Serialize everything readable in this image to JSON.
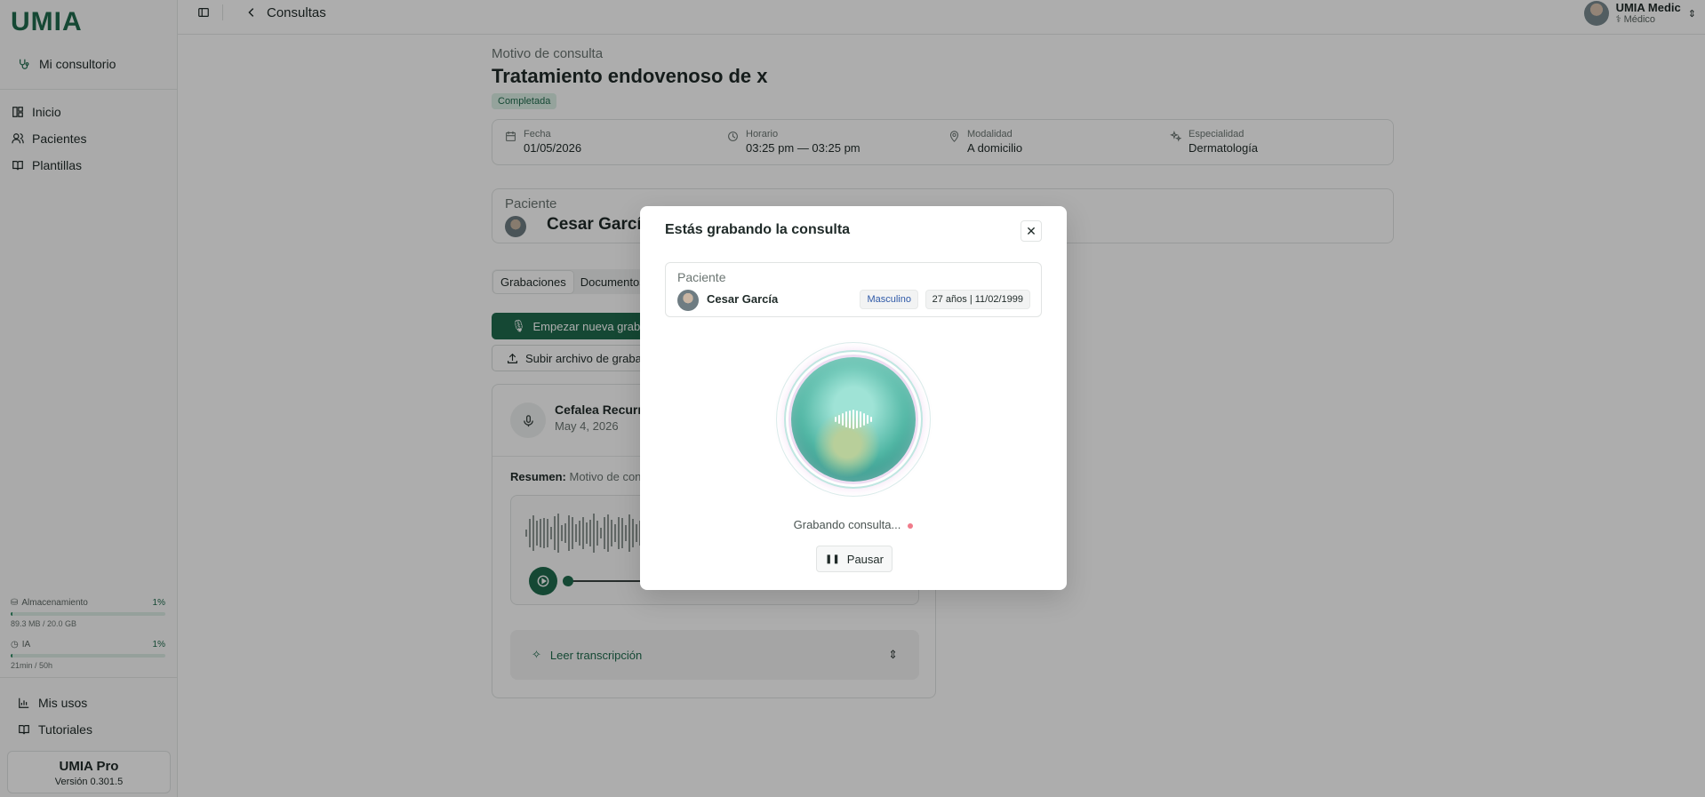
{
  "brand": {
    "logo": "UMIA"
  },
  "sidebar": {
    "office": "Mi consultorio",
    "items": [
      {
        "label": "Inicio",
        "icon": "dashboard-icon"
      },
      {
        "label": "Pacientes",
        "icon": "users-icon"
      },
      {
        "label": "Plantillas",
        "icon": "book-icon"
      }
    ],
    "storage": {
      "label": "Almacenamiento",
      "percent": "1%",
      "detail": "89.3 MB / 20.0 GB",
      "fill": 0.01
    },
    "ai": {
      "label": "IA",
      "percent": "1%",
      "detail": "21min / 50h",
      "fill": 0.01
    },
    "footer_items": [
      {
        "label": "Mis usos",
        "icon": "chart-icon"
      },
      {
        "label": "Tutoriales",
        "icon": "book-icon"
      }
    ],
    "plan": {
      "name": "UMIA Pro",
      "version": "Versión 0.301.5"
    }
  },
  "topbar": {
    "breadcrumb": "Consultas"
  },
  "user": {
    "name": "UMIA Medic",
    "role": "Médico"
  },
  "consult": {
    "kicker": "Motivo de consulta",
    "title": "Tratamiento endovenoso de x",
    "status": "Completada",
    "info": {
      "fecha_label": "Fecha",
      "fecha": "01/05/2026",
      "horario_label": "Horario",
      "horario": "03:25 pm — 03:25 pm",
      "modalidad_label": "Modalidad",
      "modalidad": "A domicilio",
      "especialidad_label": "Especialidad",
      "especialidad": "Dermatología"
    },
    "patient_label": "Paciente",
    "patient_name": "Cesar García",
    "tabs": [
      "Grabaciones",
      "Documentos"
    ],
    "btn_start": "Empezar nueva grabación",
    "btn_upload": "Subir archivo de grabación",
    "recording": {
      "title": "Cefalea Recurrente",
      "date": "May 4, 2026",
      "summary_label": "Resumen:",
      "summary": "Motivo de consulta"
    },
    "transcript": "Leer transcripción"
  },
  "modal": {
    "title": "Estás grabando la consulta",
    "patient_label": "Paciente",
    "patient_name": "Cesar García",
    "sex": "Masculino",
    "age": "27 años | 11/02/1999",
    "status": "Grabando consulta...",
    "pause": "Pausar"
  }
}
